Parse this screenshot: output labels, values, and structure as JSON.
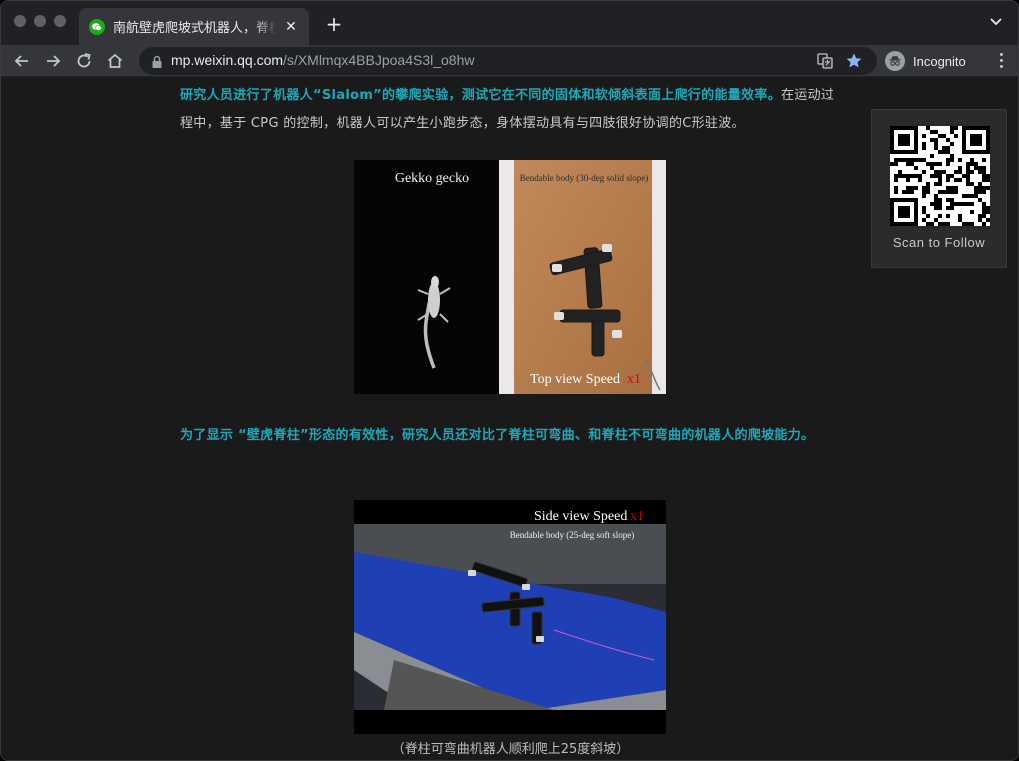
{
  "tab": {
    "title": "南航壁虎爬坡式机器人，脊柱可弯曲",
    "close": "✕",
    "new_tab": "+"
  },
  "address_bar": {
    "host": "mp.weixin.qq.com",
    "path": "/s/XMlmqx4BBJpoa4S3l_o8hw"
  },
  "profile": {
    "label": "Incognito"
  },
  "article": {
    "paragraph1_highlight": "研究人员进行了机器人“Slalom”的攀爬实验，测试它在不同的固体和软倾斜表面上爬行的能量效率。",
    "paragraph1_rest": "在运动过程中，基于 CPG 的控制，机器人可以产生小跑步态，身体摆动具有与四肢很好协调的C形驻波。",
    "paragraph2_highlight": "为了显示 “壁虎脊柱”形态的有效性，研究人员还对比了脊柱可弯曲、和脊柱不可弯曲的机器人的爬坡能力。",
    "figure1": {
      "left_label": "Gekko gecko",
      "right_label": "Bendable body (30-deg solid slope)",
      "bottom_label": "Top view  Speed",
      "speed": "x1"
    },
    "figure2": {
      "top_label": "Side view Speed",
      "speed": "x1",
      "sub_label": "Bendable body (25-deg soft slope)"
    },
    "caption": "（脊柱可弯曲机器人顺利爬上25度斜坡）"
  },
  "qr": {
    "label": "Scan to Follow"
  },
  "colors": {
    "highlight": "#1fa7b8",
    "speed_red": "#d0021b",
    "favicon_green": "#1aad19",
    "star_blue": "#8ab4f8"
  }
}
